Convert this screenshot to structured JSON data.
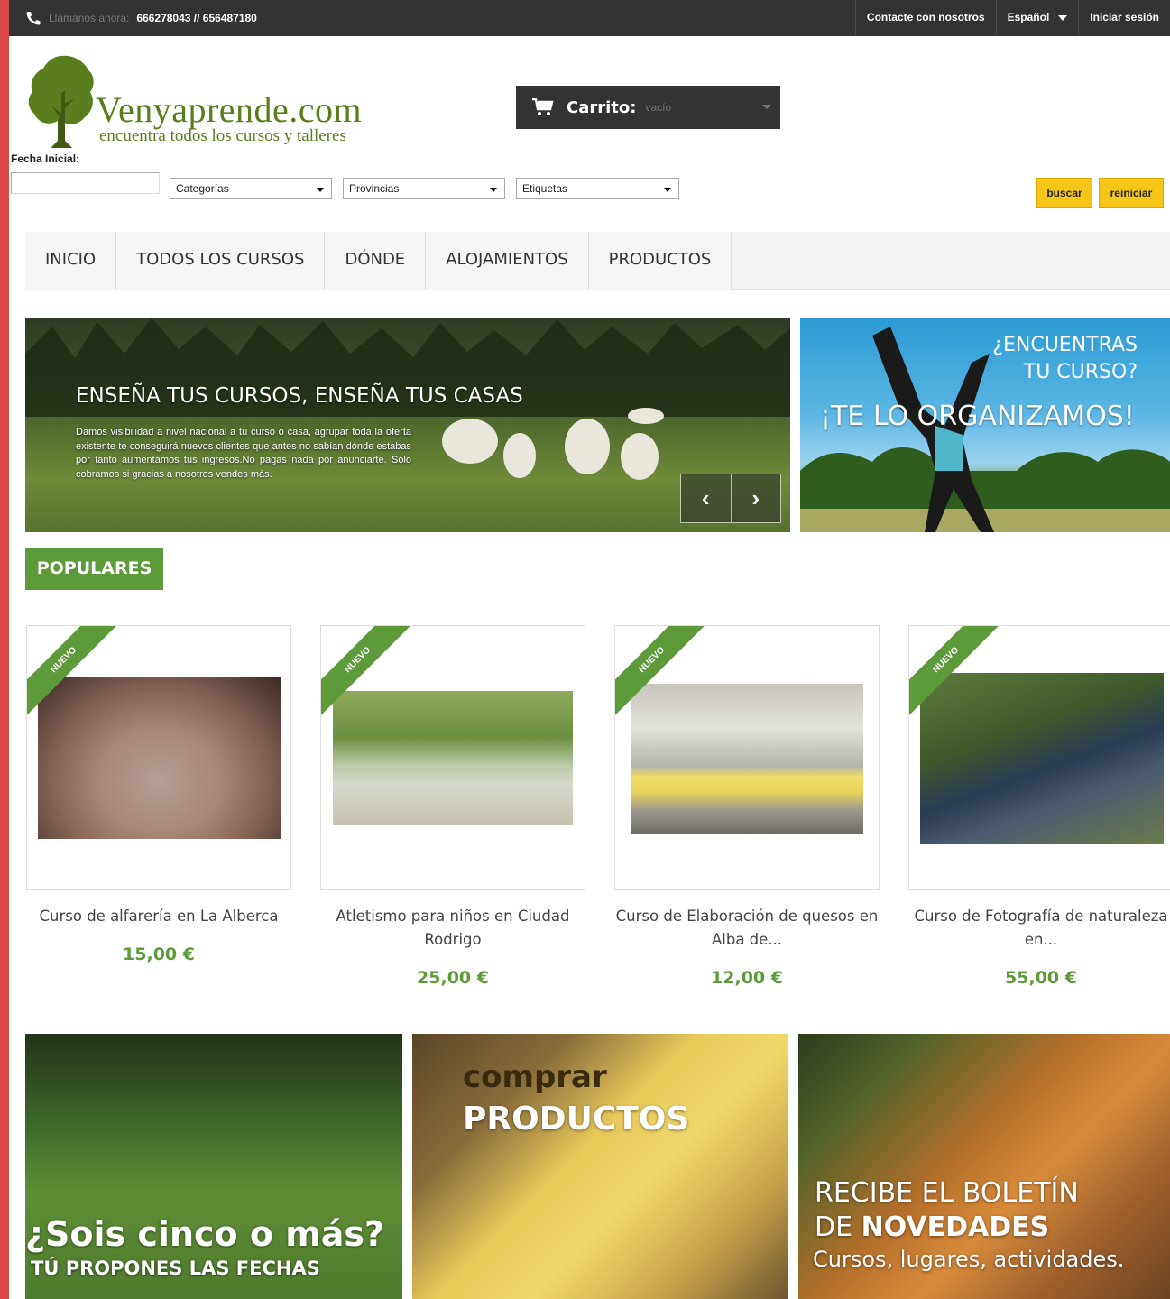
{
  "topbar": {
    "call_label": "Llámanos ahora:",
    "phones": "666278043 // 656487180",
    "contact": "Contacte con nosotros",
    "language": "Español",
    "login": "Iniciar sesión"
  },
  "brand": {
    "name": "Venyaprende.com",
    "tagline": "encuentra todos los cursos y talleres"
  },
  "cart": {
    "label": "Carrito:",
    "value": "vacío"
  },
  "filters": {
    "date_label": "Fecha Inicial:",
    "date_value": "",
    "category": "Categorías",
    "province": "Provincias",
    "tags": "Etiquetas",
    "search": "buscar",
    "reset": "reiniciar"
  },
  "nav": [
    "INICIO",
    "TODOS LOS CURSOS",
    "DÓNDE",
    "ALOJAMIENTOS",
    "PRODUCTOS"
  ],
  "slider": {
    "title": "ENSEÑA TUS CURSOS, ENSEÑA TUS CASAS",
    "description": "Damos visibilidad a nivel nacional a tu curso o casa, agrupar toda la oferta existente te conseguirá nuevos clientes que antes no sabían dónde estabas por tanto aumentamos tus ingresos.No pagas nada por anunciarte. Sólo cobramos si gracias a nosotros vendes más.",
    "prev": "‹",
    "next": "›"
  },
  "promo": {
    "question_1": "¿ENCUENTRAS",
    "question_2": "TU CURSO?",
    "headline": "¡TE LO ORGANIZAMOS!"
  },
  "section": {
    "populares": "POPULARES"
  },
  "products": [
    {
      "badge": "NUEVO",
      "name": "Curso de alfarería en La Alberca",
      "price": "15,00 €"
    },
    {
      "badge": "NUEVO",
      "name": "Atletismo para niños en Ciudad Rodrigo",
      "price": "25,00 €"
    },
    {
      "badge": "NUEVO",
      "name": "Curso de Elaboración de quesos en Alba de...",
      "price": "12,00 €"
    },
    {
      "badge": "NUEVO",
      "name": "Curso de Fotografía de naturaleza en...",
      "price": "55,00 €"
    }
  ],
  "bottom": {
    "group_title": "¿Sois cinco o más?",
    "group_sub": "TÚ PROPONES LAS FECHAS",
    "shop_1": "comprar",
    "shop_2": "PRODUCTOS",
    "news_1": "RECIBE EL BOLETÍN",
    "news_2a": "DE ",
    "news_2b": "NOVEDADES",
    "news_3": "Cursos, lugares, actividades."
  },
  "colors": {
    "accent_green": "#5d9a3a",
    "dark_bar": "#333333",
    "button_yellow": "#f5c518",
    "left_strip": "#d9474a"
  }
}
